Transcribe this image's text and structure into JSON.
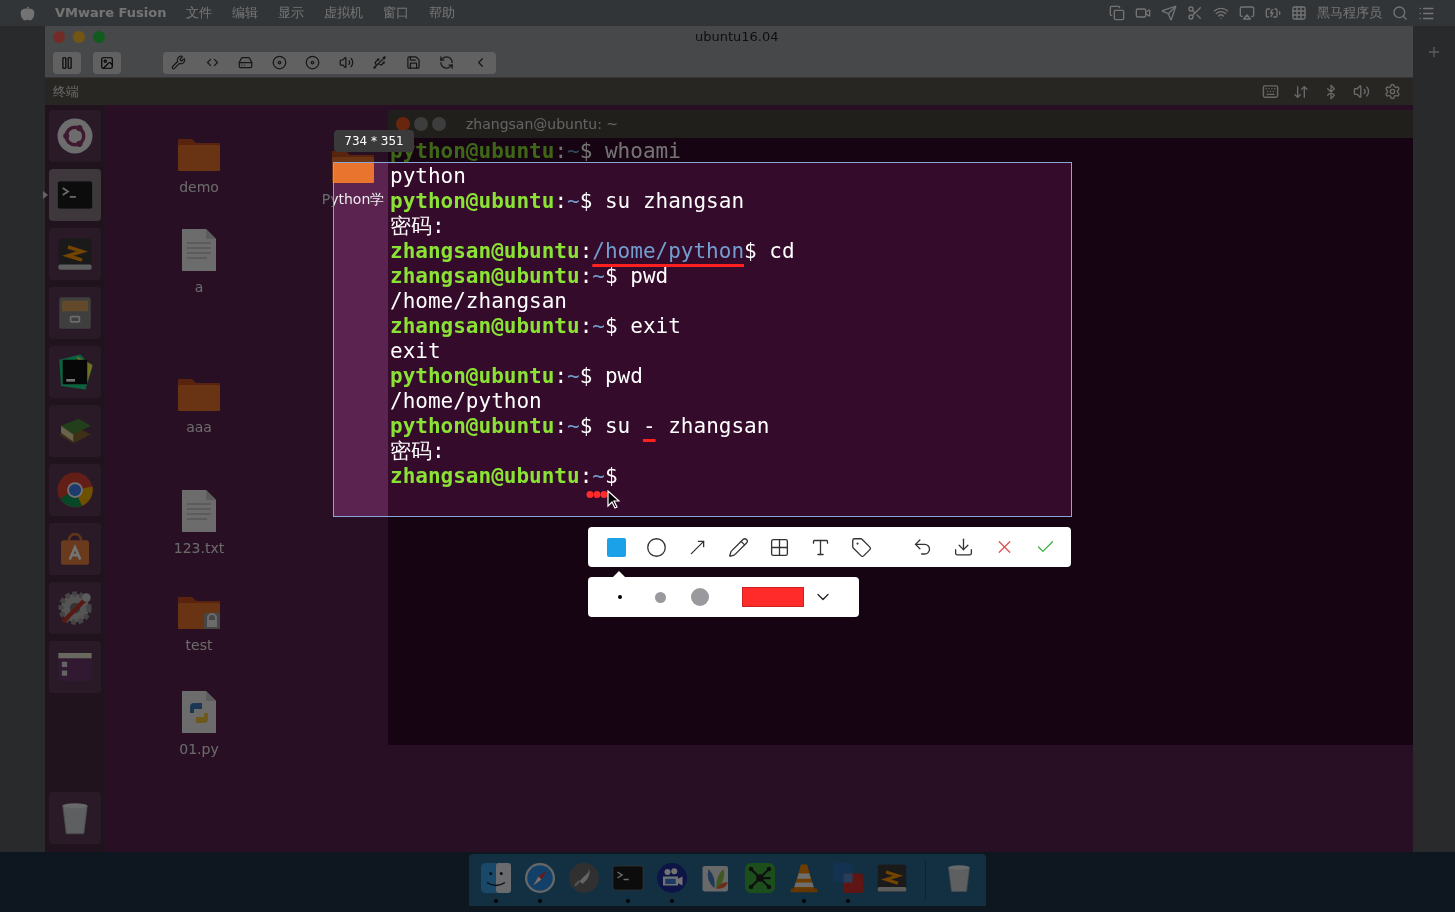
{
  "menu_bar": {
    "app": "VMware Fusion",
    "menus": [
      "文件",
      "编辑",
      "显示",
      "虚拟机",
      "窗口",
      "帮助"
    ],
    "user": "黑马程序员"
  },
  "vm_window": {
    "title": "ubuntu16.04"
  },
  "ubuntu_panel": {
    "title": "终端"
  },
  "launcher": [
    {
      "kind": "ubuntu",
      "selected": false
    },
    {
      "kind": "terminal",
      "selected": true
    },
    {
      "kind": "sublime",
      "selected": false
    },
    {
      "kind": "files",
      "selected": false
    },
    {
      "kind": "pycharm",
      "selected": false
    },
    {
      "kind": "books",
      "selected": false
    },
    {
      "kind": "chrome",
      "selected": false
    },
    {
      "kind": "software",
      "selected": false
    },
    {
      "kind": "settings",
      "selected": false
    },
    {
      "kind": "workspaces",
      "selected": false
    }
  ],
  "desktop_icons": [
    {
      "kind": "folder",
      "label": "demo"
    },
    {
      "kind": "folder",
      "label": "Python学"
    },
    {
      "kind": "file",
      "label": "a"
    },
    {
      "kind": "folder",
      "label": "aaa"
    },
    {
      "kind": "file",
      "label": "123.txt"
    },
    {
      "kind": "locked_folder",
      "label": "test"
    },
    {
      "kind": "python",
      "label": "01.py"
    }
  ],
  "terminal": {
    "title": "zhangsan@ubuntu: ~",
    "lines": [
      {
        "kind": "prompt",
        "user": "python@ubuntu",
        "sep": ":",
        "path": {
          "text": "~",
          "underlined": false
        },
        "command": [
          {
            "text": "$ whoami",
            "underlined": false
          }
        ]
      },
      {
        "kind": "output",
        "text": "python"
      },
      {
        "kind": "prompt",
        "user": "python@ubuntu",
        "sep": ":",
        "path": {
          "text": "~",
          "underlined": false
        },
        "command": [
          {
            "text": "$ su zhangsan",
            "underlined": false
          }
        ]
      },
      {
        "kind": "output",
        "text": "密码:"
      },
      {
        "kind": "prompt",
        "user": "zhangsan@ubuntu",
        "sep": ":",
        "path": {
          "text": "/home/python",
          "underlined": true
        },
        "command": [
          {
            "text": "$ cd",
            "underlined": false
          }
        ]
      },
      {
        "kind": "prompt",
        "user": "zhangsan@ubuntu",
        "sep": ":",
        "path": {
          "text": "~",
          "underlined": false
        },
        "command": [
          {
            "text": "$ pwd",
            "underlined": false
          }
        ]
      },
      {
        "kind": "output",
        "text": "/home/zhangsan"
      },
      {
        "kind": "prompt",
        "user": "zhangsan@ubuntu",
        "sep": ":",
        "path": {
          "text": "~",
          "underlined": false
        },
        "command": [
          {
            "text": "$ exit",
            "underlined": false
          }
        ]
      },
      {
        "kind": "output",
        "text": "exit"
      },
      {
        "kind": "prompt",
        "user": "python@ubuntu",
        "sep": ":",
        "path": {
          "text": "~",
          "underlined": false
        },
        "command": [
          {
            "text": "$ pwd",
            "underlined": false
          }
        ]
      },
      {
        "kind": "output",
        "text": "/home/python"
      },
      {
        "kind": "prompt",
        "user": "python@ubuntu",
        "sep": ":",
        "path": {
          "text": "~",
          "underlined": false
        },
        "command": [
          {
            "text": "$ su ",
            "underlined": false
          },
          {
            "text": "-",
            "underlined": true
          },
          {
            "text": " zhangsan",
            "underlined": false
          }
        ]
      },
      {
        "kind": "output",
        "text": "密码:"
      },
      {
        "kind": "prompt",
        "user": "zhangsan@ubuntu",
        "sep": ":",
        "path": {
          "text": "~",
          "underlined": false
        },
        "command": [
          {
            "text": "$",
            "underlined": false
          }
        ]
      }
    ]
  },
  "screenshot": {
    "size": "734 * 351",
    "tools": [
      {
        "kind": "rectangle",
        "selected": true
      },
      {
        "kind": "ellipse",
        "selected": false
      },
      {
        "kind": "arrow",
        "selected": false
      },
      {
        "kind": "pen",
        "selected": false
      },
      {
        "kind": "mosaic",
        "selected": false
      },
      {
        "kind": "text",
        "selected": false
      },
      {
        "kind": "tag",
        "selected": false
      }
    ],
    "actions": [
      {
        "kind": "undo"
      },
      {
        "kind": "download"
      },
      {
        "kind": "cancel"
      },
      {
        "kind": "confirm"
      }
    ],
    "pen_sizes": [
      {
        "selected": true
      },
      {
        "selected": false
      },
      {
        "selected": false
      }
    ],
    "color": "#ff2a2a"
  },
  "dock": [
    {
      "kind": "finder",
      "running": true
    },
    {
      "kind": "safari",
      "running": true
    },
    {
      "kind": "launchpad",
      "running": false
    },
    {
      "kind": "terminal",
      "running": true
    },
    {
      "kind": "video",
      "running": true
    },
    {
      "kind": "flowers",
      "running": false
    },
    {
      "kind": "mindmap",
      "running": false
    },
    {
      "kind": "vlc",
      "running": true
    },
    {
      "kind": "vmware",
      "running": true
    },
    {
      "kind": "sublime",
      "running": false
    }
  ]
}
